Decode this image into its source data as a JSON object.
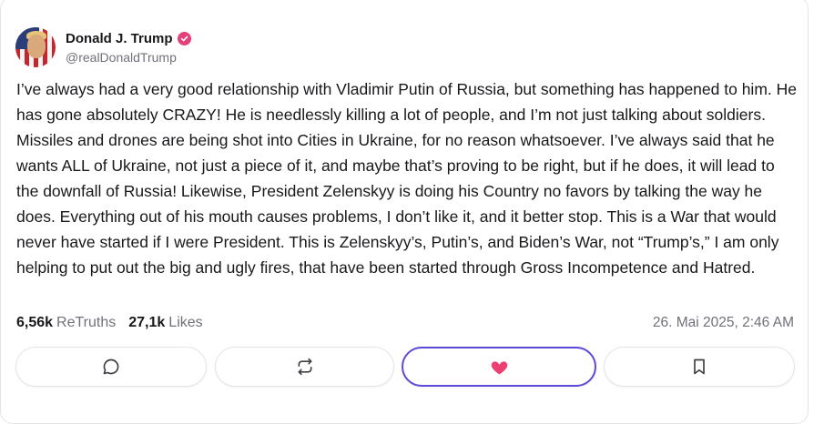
{
  "author": {
    "display_name": "Donald J. Trump",
    "handle": "@realDonaldTrump",
    "verified": true
  },
  "post": {
    "text": "I’ve always had a very good relationship with Vladimir Putin of Russia, but something has happened to him. He has gone absolutely CRAZY! He is needlessly killing a lot of people, and I’m not just talking about soldiers. Missiles and drones are being shot into Cities in Ukraine, for no reason whatsoever. I’ve always said that he wants ALL of Ukraine, not just a piece of it, and maybe that’s proving to be right, but if he does, it will lead to the downfall of Russia! Likewise, President Zelenskyy is doing his Country no favors by talking the way he does. Everything out of his mouth causes problems, I don’t like it, and it better stop. This is a War that would never have started if I were President. This is Zelenskyy’s, Putin’s, and Biden’s War, not “Trump’s,” I am only helping to put out the big and ugly fires, that have been started through Gross Incompetence and Hatred.",
    "retruths_count": "6,56k",
    "retruths_label": "ReTruths",
    "likes_count": "27,1k",
    "likes_label": "Likes",
    "timestamp": "26. Mai 2025, 2:46 AM"
  },
  "actions": [
    {
      "name": "reply",
      "icon": "comment-icon"
    },
    {
      "name": "retruth",
      "icon": "repost-icon"
    },
    {
      "name": "like",
      "icon": "heart-icon",
      "active": true
    },
    {
      "name": "bookmark",
      "icon": "bookmark-icon"
    }
  ],
  "colors": {
    "verified_badge": "#e4407a",
    "like_active": "#ec3f72",
    "like_border": "#5b4ad8",
    "muted_text": "#71717a"
  }
}
